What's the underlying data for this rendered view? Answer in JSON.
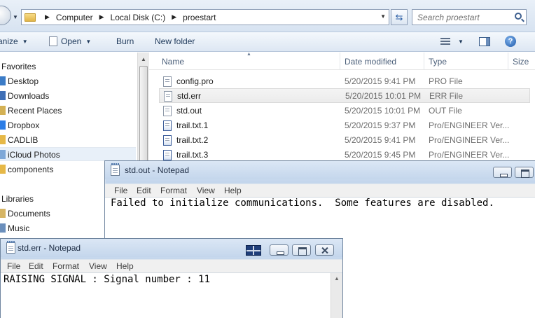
{
  "explorer": {
    "breadcrumb": [
      "Computer",
      "Local Disk (C:)",
      "proestart"
    ],
    "search_placeholder": "Search proestart",
    "toolbar": {
      "organize": "anize",
      "open": "Open",
      "burn": "Burn",
      "new_folder": "New folder"
    },
    "nav": {
      "favorites_header": "Favorites",
      "favorites": [
        "Desktop",
        "Downloads",
        "Recent Places",
        "Dropbox",
        "CADLIB",
        "iCloud Photos",
        "components"
      ],
      "libraries_header": "Libraries",
      "libraries": [
        "Documents",
        "Music"
      ]
    },
    "columns": {
      "name": "Name",
      "date": "Date modified",
      "type": "Type",
      "size": "Size"
    },
    "files": [
      {
        "name": "config.pro",
        "date": "5/20/2015 9:41 PM",
        "type": "PRO File"
      },
      {
        "name": "std.err",
        "date": "5/20/2015 10:01 PM",
        "type": "ERR File"
      },
      {
        "name": "std.out",
        "date": "5/20/2015 10:01 PM",
        "type": "OUT File"
      },
      {
        "name": "trail.txt.1",
        "date": "5/20/2015 9:37 PM",
        "type": "Pro/ENGINEER Ver..."
      },
      {
        "name": "trail.txt.2",
        "date": "5/20/2015 9:41 PM",
        "type": "Pro/ENGINEER Ver..."
      },
      {
        "name": "trail.txt.3",
        "date": "5/20/2015 9:45 PM",
        "type": "Pro/ENGINEER Ver..."
      }
    ]
  },
  "notepad_out": {
    "title": "std.out - Notepad",
    "menu": [
      "File",
      "Edit",
      "Format",
      "View",
      "Help"
    ],
    "content": "Failed to initialize communications.  Some features are disabled."
  },
  "notepad_err": {
    "title": "std.err - Notepad",
    "menu": [
      "File",
      "Edit",
      "Format",
      "View",
      "Help"
    ],
    "content": "RAISING SIGNAL : Signal number : 11"
  }
}
